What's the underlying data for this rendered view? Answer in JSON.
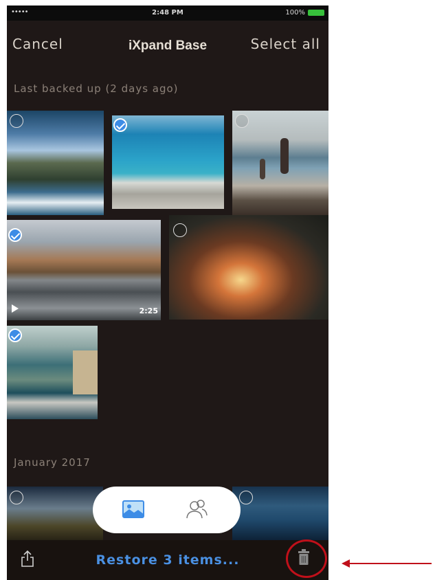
{
  "status_bar": {
    "signal": "•••••",
    "time": "2:48 PM",
    "battery": "100%"
  },
  "nav": {
    "cancel_label": "Cancel",
    "title": "iXpand Base",
    "select_all_label": "Select all"
  },
  "sections": [
    {
      "label": "Last backed up (2 days ago)"
    },
    {
      "label": "January 2017"
    }
  ],
  "photos": [
    {
      "name": "coastal-cliffs",
      "selected": false
    },
    {
      "name": "beach-umbrellas",
      "selected": true
    },
    {
      "name": "family-on-beach",
      "selected": false
    },
    {
      "name": "mountain-terrace-video",
      "selected": true,
      "duration": "2:25"
    },
    {
      "name": "campfire",
      "selected": false
    },
    {
      "name": "seaside-town",
      "selected": true
    },
    {
      "name": "grass-sunset",
      "selected": false
    },
    {
      "name": "ocean-horizon",
      "selected": false
    }
  ],
  "tabs": [
    {
      "name": "photos-tab",
      "icon": "photo-icon",
      "active": true
    },
    {
      "name": "people-tab",
      "icon": "people-icon",
      "active": false
    }
  ],
  "bottom_bar": {
    "restore_label": "Restore 3 items...",
    "share_icon": "share-icon",
    "trash_icon": "trash-icon"
  },
  "colors": {
    "accent": "#4a90e2",
    "background": "#1f1817",
    "highlight": "#c0101a"
  }
}
